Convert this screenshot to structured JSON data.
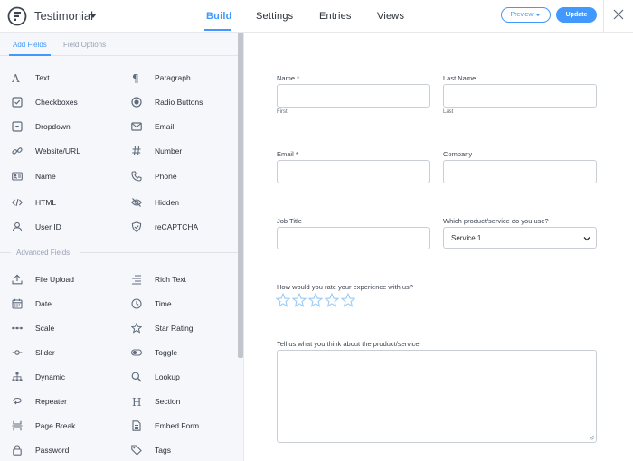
{
  "header": {
    "form_title": "Testimonial",
    "tabs": [
      {
        "label": "Build",
        "active": true
      },
      {
        "label": "Settings",
        "active": false
      },
      {
        "label": "Entries",
        "active": false
      },
      {
        "label": "Views",
        "active": false
      }
    ],
    "preview_label": "Preview",
    "update_label": "Update",
    "accent_color": "#4199fd"
  },
  "sidebar": {
    "tabs": [
      "Add Fields",
      "Field Options"
    ],
    "basic_fields": [
      {
        "label": "Text",
        "icon": "text-icon"
      },
      {
        "label": "Paragraph",
        "icon": "paragraph-icon"
      },
      {
        "label": "Checkboxes",
        "icon": "checkbox-icon"
      },
      {
        "label": "Radio Buttons",
        "icon": "radio-icon"
      },
      {
        "label": "Dropdown",
        "icon": "dropdown-icon"
      },
      {
        "label": "Email",
        "icon": "email-icon"
      },
      {
        "label": "Website/URL",
        "icon": "link-icon"
      },
      {
        "label": "Number",
        "icon": "hash-icon"
      },
      {
        "label": "Name",
        "icon": "id-card-icon"
      },
      {
        "label": "Phone",
        "icon": "phone-icon"
      },
      {
        "label": "HTML",
        "icon": "code-icon"
      },
      {
        "label": "Hidden",
        "icon": "eye-slash-icon"
      },
      {
        "label": "User ID",
        "icon": "user-icon"
      },
      {
        "label": "reCAPTCHA",
        "icon": "shield-icon"
      }
    ],
    "advanced_header": "Advanced Fields",
    "advanced_fields": [
      {
        "label": "File Upload",
        "icon": "upload-icon"
      },
      {
        "label": "Rich Text",
        "icon": "align-right-icon"
      },
      {
        "label": "Date",
        "icon": "calendar-icon"
      },
      {
        "label": "Time",
        "icon": "clock-icon"
      },
      {
        "label": "Scale",
        "icon": "dots-icon"
      },
      {
        "label": "Star Rating",
        "icon": "star-icon"
      },
      {
        "label": "Slider",
        "icon": "slider-icon"
      },
      {
        "label": "Toggle",
        "icon": "toggle-icon"
      },
      {
        "label": "Dynamic",
        "icon": "sitemap-icon"
      },
      {
        "label": "Lookup",
        "icon": "search-icon"
      },
      {
        "label": "Repeater",
        "icon": "repeat-icon"
      },
      {
        "label": "Section",
        "icon": "heading-icon"
      },
      {
        "label": "Page Break",
        "icon": "page-break-icon"
      },
      {
        "label": "Embed Form",
        "icon": "file-icon"
      },
      {
        "label": "Password",
        "icon": "lock-icon"
      },
      {
        "label": "Tags",
        "icon": "tags-icon"
      }
    ]
  },
  "form": {
    "name_label": "Name *",
    "name_sub_first": "First",
    "last_name_label": "Last Name",
    "name_sub_last": "Last",
    "email_label": "Email *",
    "company_label": "Company",
    "job_title_label": "Job Title",
    "product_label": "Which product/service do you use?",
    "product_value": "Service 1",
    "rating_label": "How would you rate your experience with us?",
    "rating_stars": 5,
    "feedback_label": "Tell us what you think about the product/service."
  }
}
